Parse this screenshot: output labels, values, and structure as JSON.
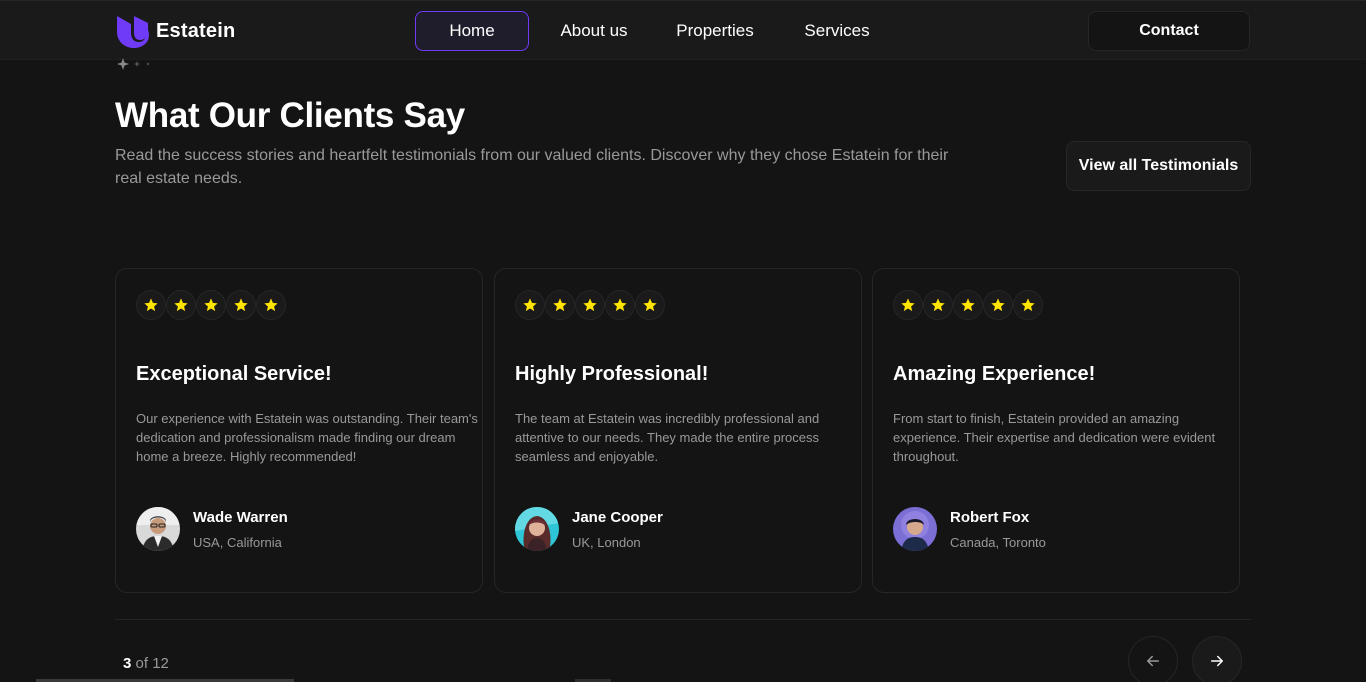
{
  "brand": {
    "name": "Estatein",
    "accent": "#703bf7"
  },
  "nav": {
    "items": [
      {
        "label": "Home",
        "active": true
      },
      {
        "label": "About us",
        "active": false
      },
      {
        "label": "Properties",
        "active": false
      },
      {
        "label": "Services",
        "active": false
      }
    ],
    "contact_label": "Contact"
  },
  "section": {
    "title": "What Our Clients Say",
    "subtitle": "Read the success stories and heartfelt testimonials from our valued clients. Discover why they chose Estatein for their real estate needs.",
    "view_all_label": "View all Testimonials"
  },
  "testimonials": [
    {
      "rating": 5,
      "title": "Exceptional Service!",
      "body": "Our experience with Estatein was outstanding. Their team's dedication and professionalism made finding our dream home a breeze. Highly recommended!",
      "author": "Wade Warren",
      "location": "USA, California"
    },
    {
      "rating": 5,
      "title": "Highly Professional!",
      "body": "The team at Estatein was incredibly professional and attentive to our needs. They made the entire process seamless and enjoyable.",
      "author": "Jane Cooper",
      "location": "UK, London"
    },
    {
      "rating": 5,
      "title": "Amazing Experience!",
      "body": "From start to finish, Estatein provided an amazing experience. Their expertise and dedication were evident throughout.",
      "author": "Robert Fox",
      "location": "Canada, Toronto"
    }
  ],
  "pagination": {
    "current": "3",
    "rest": " of 12"
  },
  "colors": {
    "star": "#ffe500",
    "background": "#141414",
    "muted_text": "#999999"
  },
  "icons": {
    "prev": "arrow-left-icon",
    "next": "arrow-right-icon",
    "star": "star-icon"
  }
}
